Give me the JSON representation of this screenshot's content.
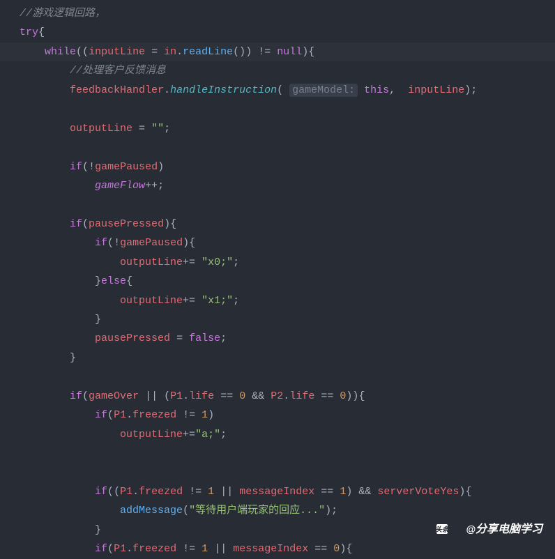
{
  "code": {
    "comment_game_logic": "//游戏逻辑回路，",
    "kw_try": "try",
    "brace_open": "{",
    "brace_close": "}",
    "kw_while": "while",
    "paren_open": "(",
    "paren_close": ")",
    "var_inputLine": "inputLine",
    "op_assign": "=",
    "var_in": "in",
    "dot": ".",
    "method_readLine": "readLine",
    "empty_parens": "()",
    "op_neq": "!=",
    "kw_null": "null",
    "comment_handle": "//处理客户反馈消息",
    "var_feedbackHandler": "feedbackHandler",
    "method_handleInstruction": "handleInstruction",
    "hint_gameModel": "gameModel:",
    "kw_this": "this",
    "comma": ",",
    "semicolon": ";",
    "var_outputLine": "outputLine",
    "str_empty": "\"\"",
    "kw_if": "if",
    "op_not": "!",
    "var_gamePaused": "gamePaused",
    "var_gameFlow": "gameFlow",
    "op_inc": "++",
    "var_pausePressed": "pausePressed",
    "kw_else": "else",
    "op_plus_assign": "+=",
    "str_x0": "\"x0;\"",
    "str_x1": "\"x1;\"",
    "kw_false": "false",
    "var_gameOver": "gameOver",
    "op_or": "||",
    "op_and": "&&",
    "var_P1": "P1",
    "var_P2": "P2",
    "prop_life": "life",
    "op_eq": "==",
    "num_0": "0",
    "num_1": "1",
    "prop_freezed": "freezed",
    "str_a": "\"a;\"",
    "var_messageIndex": "messageIndex",
    "var_serverVoteYes": "serverVoteYes",
    "method_addMessage": "addMessage",
    "str_wait": "\"等待用户端玩家的回应...\""
  },
  "watermark": {
    "logo_text": "头条",
    "at": "@",
    "name": "分享电脑学习"
  }
}
